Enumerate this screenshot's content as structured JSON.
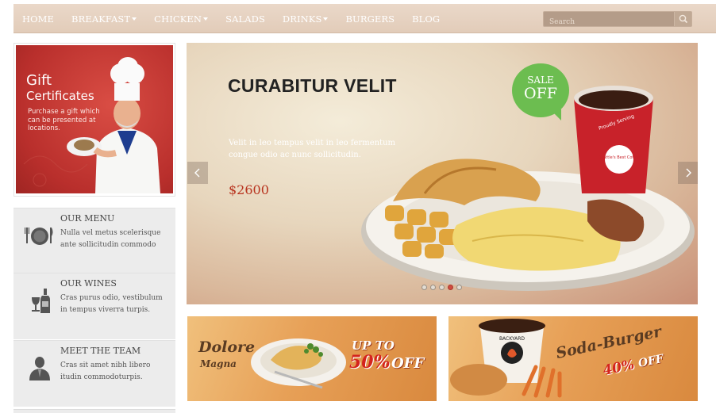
{
  "nav": {
    "items": [
      {
        "label": "HOME",
        "dropdown": false
      },
      {
        "label": "BREAKFAST",
        "dropdown": true
      },
      {
        "label": "CHICKEN",
        "dropdown": true
      },
      {
        "label": "SALADS",
        "dropdown": false
      },
      {
        "label": "DRINKS",
        "dropdown": true
      },
      {
        "label": "BURGERS",
        "dropdown": false
      },
      {
        "label": "BLOG",
        "dropdown": false
      }
    ],
    "search_placeholder": "Search"
  },
  "gift": {
    "title": "Gift",
    "subtitle": "Certificates",
    "description": "Purchase a gift which can be presented at locations."
  },
  "info_boxes": [
    {
      "title": "OUR MENU",
      "text": "Nulla vel metus scelerisque ante sollicitudin commodo",
      "icon": "plate-fork-knife-icon"
    },
    {
      "title": "OUR WINES",
      "text": "Cras purus odio, vestibulum in tempus viverra turpis.",
      "icon": "wine-icon"
    },
    {
      "title": "MEET THE TEAM",
      "text": "Cras sit amet nibh libero itudin commodoturpis.",
      "icon": "person-icon"
    }
  ],
  "slider": {
    "title": "CURABITUR VELIT",
    "text": "Velit in leo tempus velit in leo fermentum congue odio ac nunc sollicitudin.",
    "price": "$2600",
    "badge_line1": "SALE",
    "badge_line2": "OFF",
    "slide_count": 5,
    "active_slide": 4,
    "cup_label": "Seattle's Best Coffee",
    "cup_text": "Proudly Serving"
  },
  "banners": {
    "left": {
      "name": "Dolore",
      "sub": "Magna",
      "up_to": "UP TO",
      "discount": "50%",
      "off": "OFF"
    },
    "right": {
      "name": "Soda-Burger",
      "discount": "40%",
      "off": "OFF",
      "cup_text": "BACKYARD"
    }
  },
  "colors": {
    "accent_red": "#cf4a3e",
    "badge_green": "#6cbd50",
    "nav_bg": "#e2ccb9",
    "price_red": "#b8341f"
  }
}
